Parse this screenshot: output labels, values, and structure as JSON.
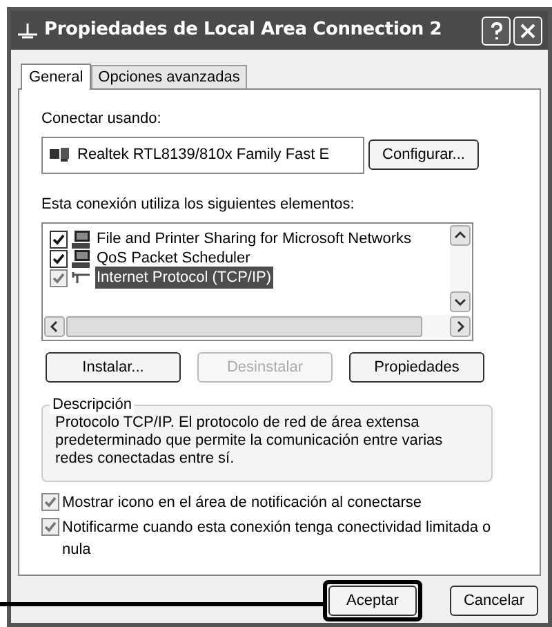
{
  "window": {
    "title": "Propiedades de Local Area Connection 2"
  },
  "tabs": [
    {
      "label": "General",
      "selected": true
    },
    {
      "label": "Opciones avanzadas",
      "selected": false
    }
  ],
  "connect_using": {
    "label": "Conectar usando:",
    "adapter": "Realtek RTL8139/810x Family Fast E",
    "button": "Configurar..."
  },
  "components": {
    "label": "Esta conexión utiliza los siguientes elementos:",
    "items": [
      {
        "kind": "service",
        "label": "File and Printer Sharing for Microsoft Networks",
        "checked": true,
        "selected": false
      },
      {
        "kind": "service",
        "label": "QoS Packet Scheduler",
        "checked": true,
        "selected": false
      },
      {
        "kind": "protocol",
        "label": "Internet Protocol (TCP/IP)",
        "checked": true,
        "selected": true
      }
    ]
  },
  "component_buttons": [
    {
      "label": "Instalar...",
      "disabled": false
    },
    {
      "label": "Desinstalar",
      "disabled": true
    },
    {
      "label": "Propiedades",
      "disabled": false
    }
  ],
  "description": {
    "legend": "Descripción",
    "text": "Protocolo TCP/IP. El protocolo de red de área extensa predeterminado que permite la comunicación entre varias redes conectadas entre sí."
  },
  "options": [
    {
      "label": "Mostrar icono en el área de notificación al conectarse",
      "checked": true
    },
    {
      "label": "Notificarme cuando esta conexión tenga conectividad limitada o nula",
      "checked": true
    }
  ],
  "footer_buttons": [
    {
      "label": "Aceptar",
      "highlighted": true
    },
    {
      "label": "Cancelar",
      "highlighted": false
    }
  ]
}
